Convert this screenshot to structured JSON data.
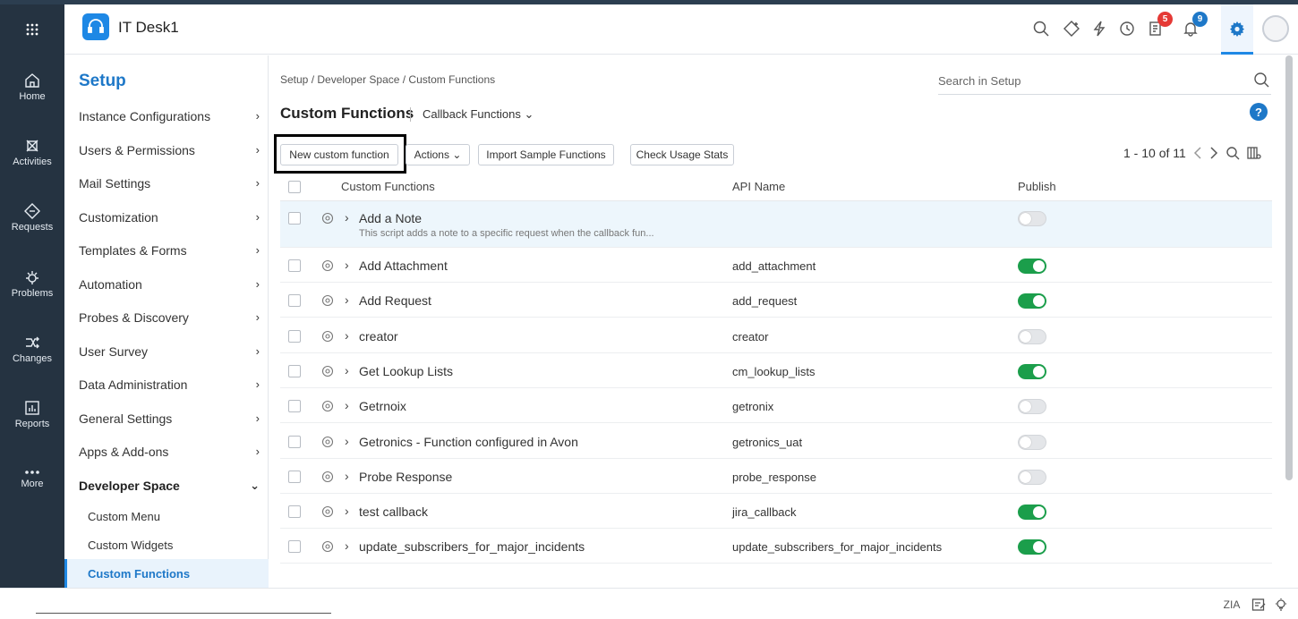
{
  "app": {
    "title": "IT Desk1"
  },
  "leftnav": [
    {
      "label": "Home",
      "icon": "home-icon"
    },
    {
      "label": "Activities",
      "icon": "activities-icon"
    },
    {
      "label": "Requests",
      "icon": "requests-icon"
    },
    {
      "label": "Problems",
      "icon": "problems-icon"
    },
    {
      "label": "Changes",
      "icon": "changes-icon"
    },
    {
      "label": "Reports",
      "icon": "reports-icon"
    },
    {
      "label": "More",
      "icon": "more-icon"
    }
  ],
  "header": {
    "badges": {
      "tasks": "5",
      "notifications": "9"
    },
    "badge_colors": {
      "tasks": "#e53935",
      "notifications": "#1e78c8"
    }
  },
  "sidebar": {
    "title": "Setup",
    "items": [
      {
        "label": "Instance Configurations",
        "chevron": "›"
      },
      {
        "label": "Users & Permissions",
        "chevron": "›"
      },
      {
        "label": "Mail Settings",
        "chevron": "›"
      },
      {
        "label": "Customization",
        "chevron": "›"
      },
      {
        "label": "Templates & Forms",
        "chevron": "›"
      },
      {
        "label": "Automation",
        "chevron": "›"
      },
      {
        "label": "Probes & Discovery",
        "chevron": "›"
      },
      {
        "label": "User Survey",
        "chevron": "›"
      },
      {
        "label": "Data Administration",
        "chevron": "›"
      },
      {
        "label": "General Settings",
        "chevron": "›"
      },
      {
        "label": "Apps & Add-ons",
        "chevron": "›"
      },
      {
        "label": "Developer Space",
        "chevron": "⌄"
      }
    ],
    "subitems": [
      {
        "label": "Custom Menu"
      },
      {
        "label": "Custom Widgets"
      },
      {
        "label": "Custom Functions"
      }
    ]
  },
  "main": {
    "breadcrumb": "Setup / Developer Space / Custom Functions",
    "search_placeholder": "Search in Setup",
    "title": "Custom Functions",
    "view": "Callback Functions",
    "help": "?",
    "toolbar": {
      "new_button": "New custom function",
      "actions": "Actions",
      "import": "Import Sample Functions",
      "usage": "Check Usage Stats"
    },
    "pager": "1 - 10 of 11",
    "columns": {
      "name": "Custom Functions",
      "api": "API Name",
      "publish": "Publish"
    },
    "rows": [
      {
        "name": "Add a Note",
        "description": "This script adds a note to a specific request when the callback fun...",
        "api": "",
        "published": false
      },
      {
        "name": "Add Attachment",
        "description": "",
        "api": "add_attachment",
        "published": true
      },
      {
        "name": "Add Request",
        "description": "",
        "api": "add_request",
        "published": true
      },
      {
        "name": "creator",
        "description": "",
        "api": "creator",
        "published": false
      },
      {
        "name": "Get Lookup Lists",
        "description": "",
        "api": "cm_lookup_lists",
        "published": true
      },
      {
        "name": "Getrnoix",
        "description": "",
        "api": "getronix",
        "published": false
      },
      {
        "name": "Getronics - Function configured in Avon",
        "description": "",
        "api": "getronics_uat",
        "published": false
      },
      {
        "name": "Probe Response",
        "description": "",
        "api": "probe_response",
        "published": false
      },
      {
        "name": "test callback",
        "description": "",
        "api": "jira_callback",
        "published": true
      },
      {
        "name": "update_subscribers_for_major_incidents",
        "description": "",
        "api": "update_subscribers_for_major_incidents",
        "published": true
      }
    ]
  },
  "footer": {
    "zia": "ZIA"
  },
  "colors": {
    "accent": "#1e78c8",
    "nav_bg": "#253341",
    "toggle_on": "#1b9e4b"
  }
}
